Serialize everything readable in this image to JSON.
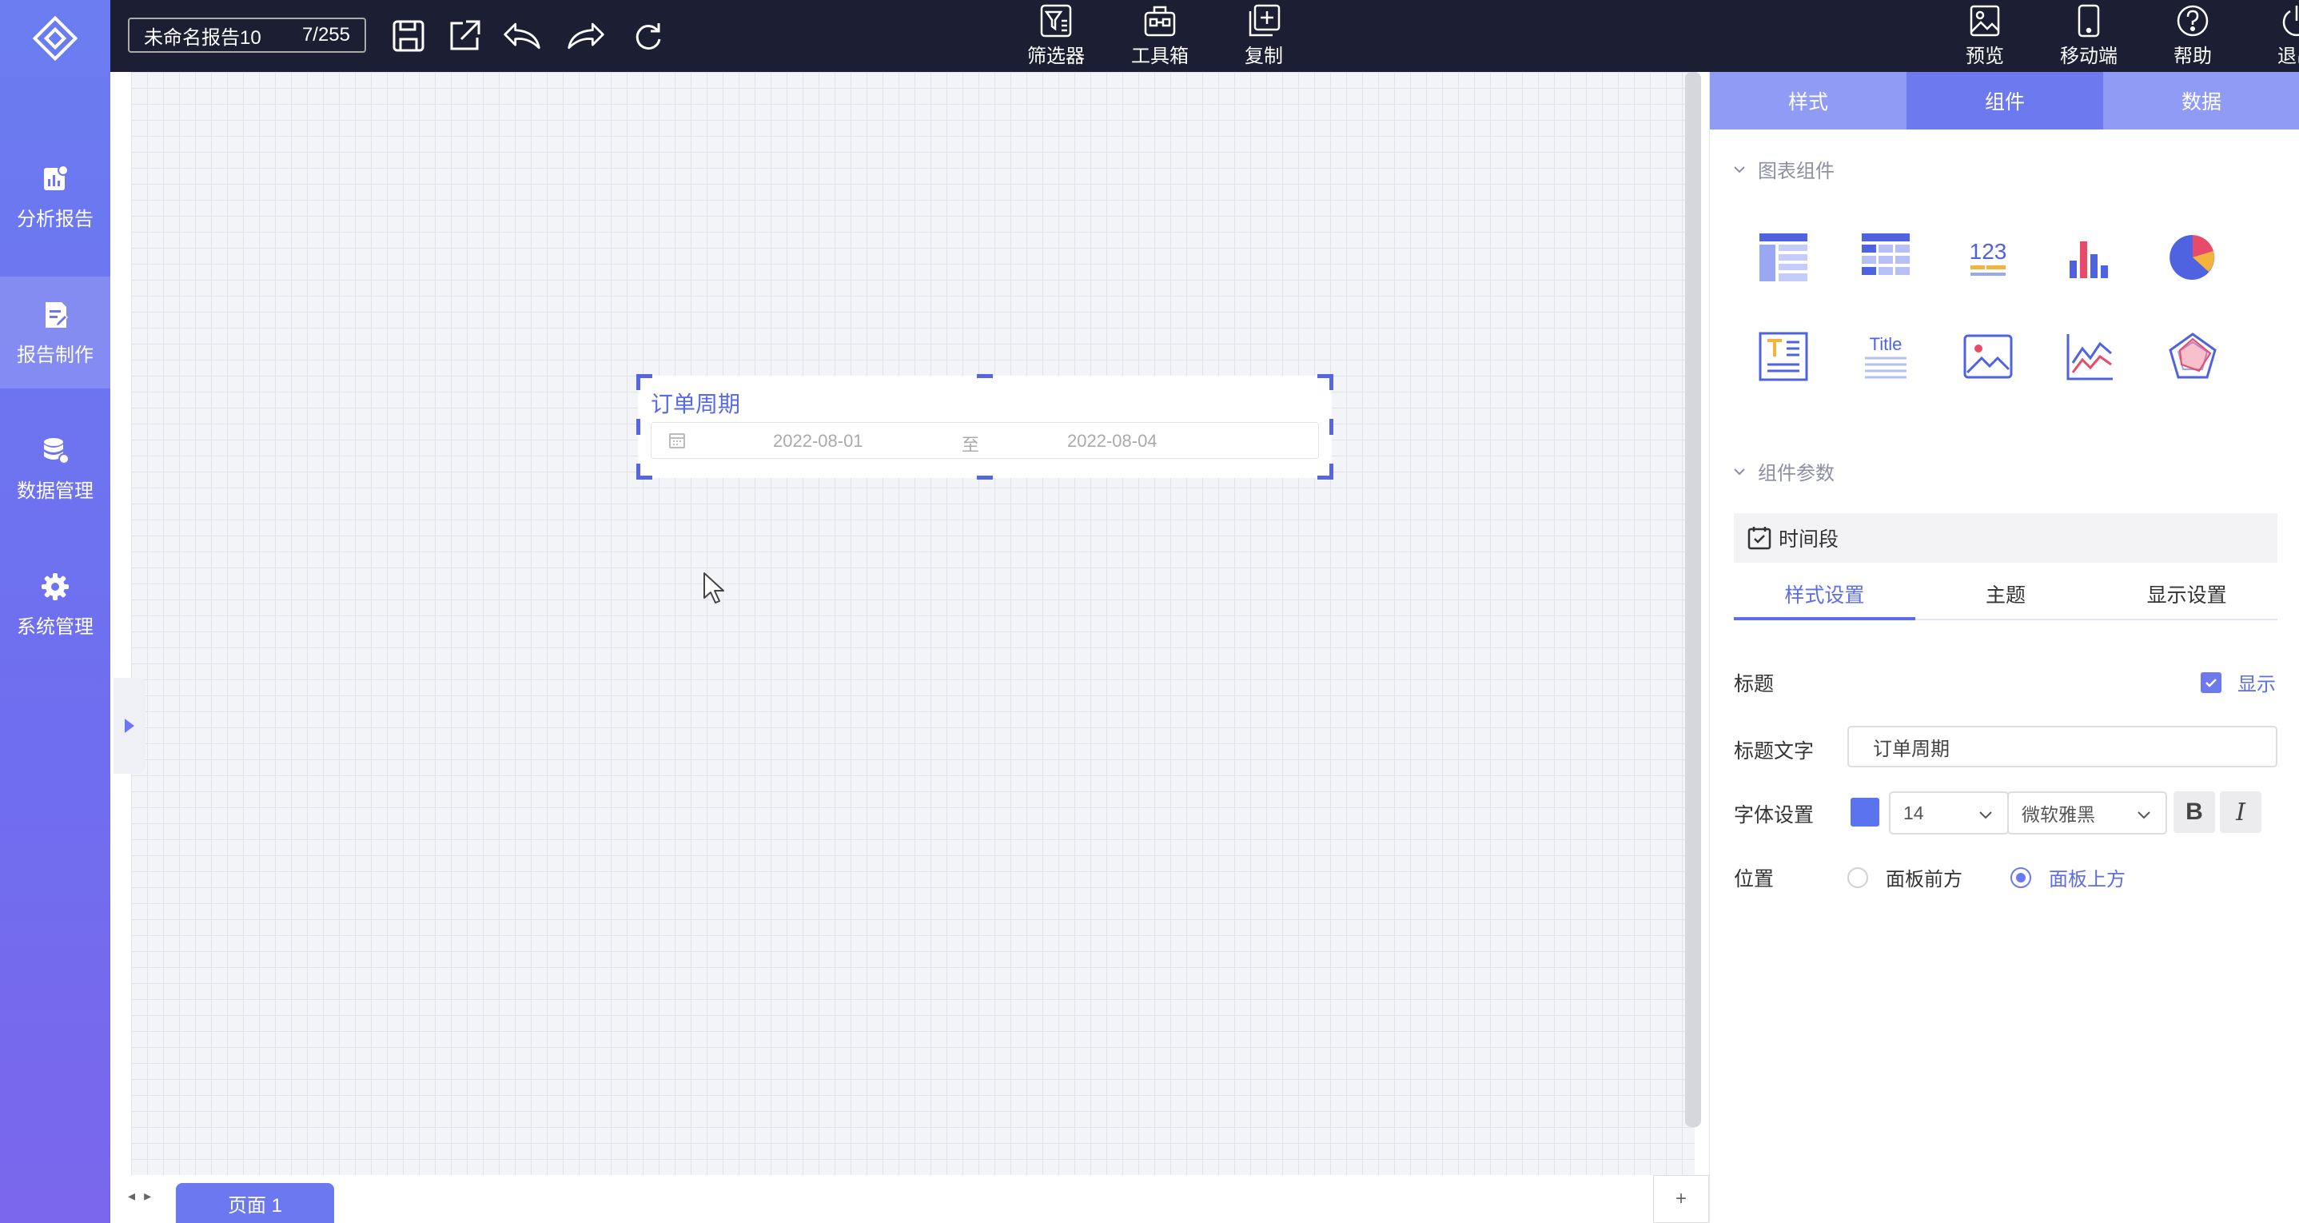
{
  "sidebar": {
    "items": [
      {
        "label": "分析报告",
        "icon": "chart-report-icon"
      },
      {
        "label": "报告制作",
        "icon": "edit-report-icon"
      },
      {
        "label": "数据管理",
        "icon": "database-icon"
      },
      {
        "label": "系统管理",
        "icon": "gear-icon"
      }
    ]
  },
  "toolbar": {
    "doc_title": "未命名报告10",
    "doc_count": "7/255",
    "filter_label": "筛选器",
    "toolbox_label": "工具箱",
    "copy_label": "复制",
    "preview_label": "预览",
    "mobile_label": "移动端",
    "help_label": "帮助",
    "logout_label": "退出"
  },
  "canvas": {
    "widget": {
      "title": "订单周期",
      "start_date": "2022-08-01",
      "separator": "至",
      "end_date": "2022-08-04"
    },
    "page_tab": "页面 1",
    "add_page": "+"
  },
  "panel": {
    "tabs": [
      "样式",
      "组件",
      "数据"
    ],
    "active_tab": "组件",
    "chart_section": "图表组件",
    "components": [
      "table-widget-icon",
      "grid-table-widget-icon",
      "number-widget-icon",
      "bar-chart-widget-icon",
      "pie-chart-widget-icon",
      "text-widget-icon",
      "title-widget-icon",
      "image-widget-icon",
      "line-chart-widget-icon",
      "radar-chart-widget-icon"
    ],
    "number_icon_text": "123",
    "title_icon_text": "Title",
    "params_section": "组件参数",
    "widget_type": "时间段",
    "sub_tabs": [
      "样式设置",
      "主题",
      "显示设置"
    ],
    "form": {
      "title_label": "标题",
      "show_label": "显示",
      "title_text_label": "标题文字",
      "title_text_value": "订单周期",
      "font_label": "字体设置",
      "font_color": "#5b73ee",
      "font_size": "14",
      "font_family": "微软雅黑",
      "bold": "B",
      "italic": "I",
      "position_label": "位置",
      "position_options": [
        "面板前方",
        "面板上方"
      ],
      "position_selected": "面板上方"
    }
  }
}
